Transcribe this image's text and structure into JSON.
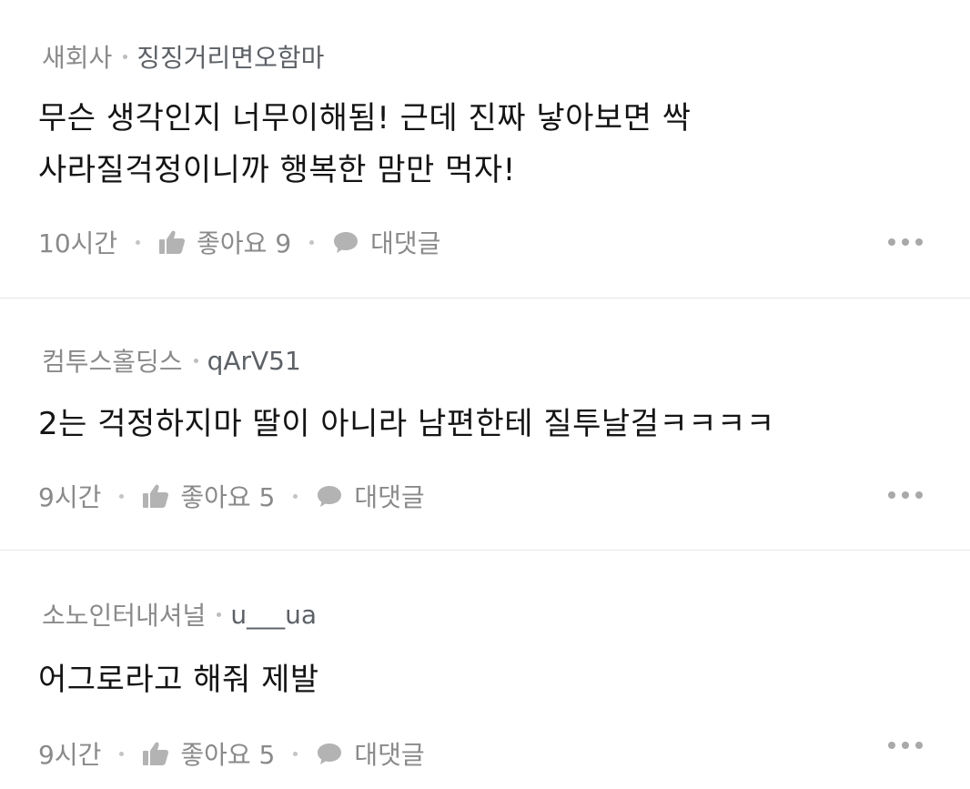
{
  "comments": [
    {
      "company": "새회사",
      "nickname": "징징거리면오함마",
      "text": "무슨 생각인지 너무이해됨! 근데 진짜 낳아보면 싹\n사라질걱정이니까 행복한 맘만 먹자!",
      "time": "10시간",
      "like_label": "좋아요 9",
      "reply_label": "대댓글"
    },
    {
      "company": "컴투스홀딩스",
      "nickname": "qArV51",
      "text": "2는 걱정하지마 딸이 아니라 남편한테 질투날걸ㅋㅋㅋㅋ",
      "time": "9시간",
      "like_label": "좋아요 5",
      "reply_label": "대댓글"
    },
    {
      "company": "소노인터내셔널",
      "nickname": "u___ua",
      "text": "어그로라고 해줘 제발",
      "time": "9시간",
      "like_label": "좋아요 5",
      "reply_label": "대댓글"
    }
  ],
  "icons": {
    "like": "thumbs-up-icon",
    "reply": "speech-bubble-icon",
    "more": "more-horizontal-icon"
  },
  "colors": {
    "meta_text": "#8a8a8a",
    "nickname": "#5c6166",
    "body_text": "#141414",
    "icon": "#b3b3b3",
    "divider": "#e6e6e6"
  }
}
